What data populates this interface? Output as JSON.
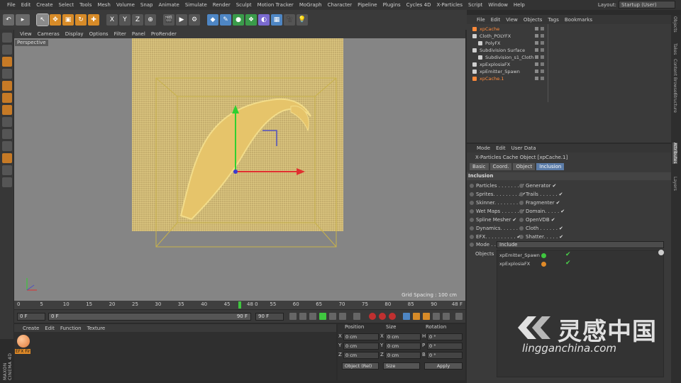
{
  "menu": [
    "File",
    "Edit",
    "Create",
    "Select",
    "Tools",
    "Mesh",
    "Volume",
    "Snap",
    "Animate",
    "Simulate",
    "Render",
    "Sculpt",
    "Motion Tracker",
    "MoGraph",
    "Character",
    "Pipeline",
    "Plugins",
    "Cycles 4D",
    "X-Particles",
    "Script",
    "Window",
    "Help"
  ],
  "layout": {
    "label": "Layout:",
    "value": "Startup (User)"
  },
  "viewport": {
    "menu": [
      "View",
      "Cameras",
      "Display",
      "Options",
      "Filter",
      "Panel",
      "ProRender"
    ],
    "label": "Perspective",
    "grid_spacing": "Grid Spacing : 100 cm"
  },
  "timeline": {
    "ticks": [
      "0",
      "5",
      "10",
      "15",
      "20",
      "25",
      "30",
      "35",
      "40",
      "45",
      "48 0",
      "55",
      "60",
      "65",
      "70",
      "75",
      "80",
      "85",
      "90"
    ],
    "end_frame": "48 F",
    "start_field": "0 F",
    "range_start": "0 F",
    "range_end": "90 F",
    "max_field": "90 F"
  },
  "materials": {
    "menu": [
      "Create",
      "Edit",
      "Function",
      "Texture"
    ],
    "item_label": "EFX Fir"
  },
  "coords": {
    "headers": [
      "Position",
      "Size",
      "Rotation"
    ],
    "rows": [
      {
        "axis": "X",
        "pos": "0 cm",
        "size_axis": "X",
        "size": "0 cm",
        "rot_axis": "H",
        "rot": "0 °"
      },
      {
        "axis": "Y",
        "pos": "0 cm",
        "size_axis": "Y",
        "size": "0 cm",
        "rot_axis": "P",
        "rot": "0 °"
      },
      {
        "axis": "Z",
        "pos": "0 cm",
        "size_axis": "Z",
        "size": "0 cm",
        "rot_axis": "B",
        "rot": "0 °"
      }
    ],
    "mode": "Object (Rel)",
    "size_mode": "Size",
    "apply": "Apply"
  },
  "brand": "MAXON CINEMA 4D",
  "objects": {
    "menu": [
      "File",
      "Edit",
      "View",
      "Objects",
      "Tags",
      "Bookmarks"
    ],
    "items": [
      {
        "name": "xpCache",
        "color": "#ff8a3a"
      },
      {
        "name": "Cloth_POLYFX",
        "color": "#cfcfcf"
      },
      {
        "name": "PolyFX",
        "color": "#cfcfcf"
      },
      {
        "name": "Subdivision Surface",
        "color": "#cfcfcf"
      },
      {
        "name": "Subdivision_s1_Cloth",
        "color": "#cfcfcf"
      },
      {
        "name": "xpExplosiaFX",
        "color": "#cfcfcf"
      },
      {
        "name": "xpEmitter_Spawn",
        "color": "#cfcfcf"
      },
      {
        "name": "xpCache.1",
        "color": "#ff8a3a"
      }
    ]
  },
  "attributes": {
    "menu": [
      "Mode",
      "Edit",
      "User Data"
    ],
    "title": "X-Particles Cache Object [xpCache.1]",
    "tabs": [
      "Basic",
      "Coord.",
      "Object",
      "Inclusion"
    ],
    "section": "Inclusion",
    "left_options": [
      "Particles . . . . . . .",
      "Sprites. . . . . . . . .",
      "Skinner. . . . . . . .",
      "Wet Maps . . . . . .",
      "Spline Mesher",
      "Dynamics. . . . . .",
      "EFX. . . . . . . . . ."
    ],
    "right_options": [
      "Generator",
      "Trails . . . . . .",
      "Fragmenter",
      "Domain. . . . .",
      "OpenVDB",
      "Cloth . . . . . .",
      "Shatter. . . . ."
    ],
    "mode_label": "Mode . . .",
    "mode_value": "Include",
    "objects_label": "Objects",
    "objects_list": [
      "xpEmitter_Spawn",
      "xpExplosiaFX"
    ]
  },
  "right_tabs": [
    "Objects",
    "Takes",
    "Content Browser",
    "Structure",
    "Attributes",
    "Layers"
  ],
  "watermark": {
    "cn": "灵感中国",
    "url": "lingganchina.com"
  }
}
